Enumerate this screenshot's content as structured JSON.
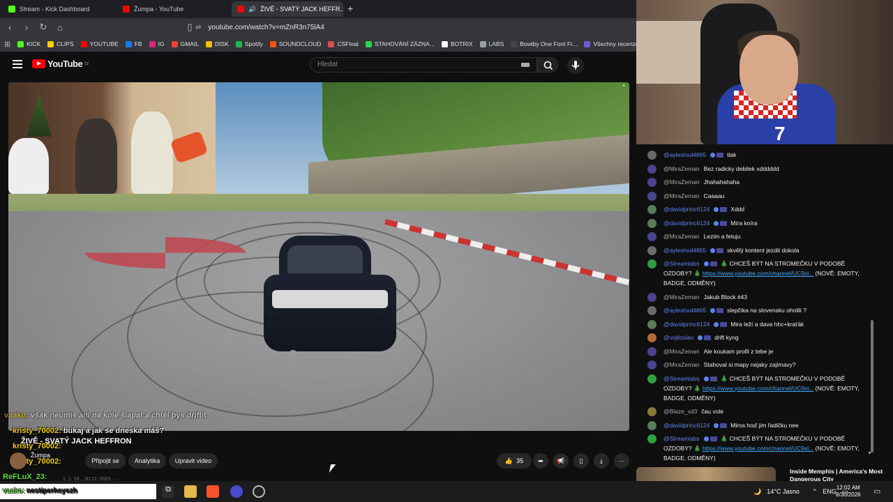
{
  "tabs": [
    {
      "label": "Stream - Kick Dashboard",
      "color": "#53fc18"
    },
    {
      "label": "Žumpa - YouTube",
      "color": "#ff0000"
    },
    {
      "label": "ŽIVĚ - SVATÝ JACK HEFFR...",
      "color": "#ff0000"
    }
  ],
  "new_tab": "+",
  "url": "youtube.com/watch?v=mZnR3n75lA4",
  "bookmarks": [
    {
      "label": "KICK",
      "color": "#53fc18"
    },
    {
      "label": "CLIPS",
      "color": "#f5d000"
    },
    {
      "label": "YOUTUBE",
      "color": "#ff0000"
    },
    {
      "label": "FB",
      "color": "#1877f2"
    },
    {
      "label": "IG",
      "color": "#d62976"
    },
    {
      "label": "GMAIL",
      "color": "#ea4335"
    },
    {
      "label": "DISK",
      "color": "#fbbc04"
    },
    {
      "label": "Spotify",
      "color": "#1db954"
    },
    {
      "label": "SOUNDCLOUD",
      "color": "#ff5500"
    },
    {
      "label": "CSFloat",
      "color": "#e24c4c"
    },
    {
      "label": "STAHOVÁNÍ ZÁZNA...",
      "color": "#2fd152"
    },
    {
      "label": "BOTRIX",
      "color": "#ffffff"
    },
    {
      "label": "LABS",
      "color": "#9aa0a6"
    },
    {
      "label": "Bowlby One Font Fr...",
      "color": "#444444"
    },
    {
      "label": "Všechny recenze",
      "color": "#6f5bd7"
    }
  ],
  "youtube": {
    "logo": "YouTube",
    "logo_sup": "CZ",
    "search_placeholder": "Hledat"
  },
  "overlay": {
    "line1_nick": "vaako:",
    "line1_text": "však neumíš ani na kole šlapat a chtěl bys driftit",
    "line2_nick": "kristy_70002:",
    "line2_text": "bukaj a jak se dneska máš?",
    "line3_nick": "kristy_70002:",
    "line4_nick": "kristy_70002:",
    "line5_nick": "ReFLuX_23:",
    "taskbar_nick": "vaako:",
    "taskbar_text": "nestiperheyezh"
  },
  "video": {
    "title": "ŽIVĚ - SVATÝ JACK HEFFRON",
    "channel": "Žumpa",
    "join_label": "Připojit se",
    "analytics_label": "Analytika",
    "edit_label": "Upravit video",
    "likes": "35",
    "meta": "1. 1. 20... 30.12. 2023 · ..."
  },
  "chat": [
    {
      "author": "@ayleshxd4865",
      "mod": true,
      "text": "tlak",
      "color": "#6a6a6a"
    },
    {
      "author": "@MiraZeman",
      "mod": false,
      "text": "Bez radicky debilek xdddddd",
      "color": "#4a4490"
    },
    {
      "author": "@MiraZeman",
      "mod": false,
      "text": "Jhahahahaha",
      "color": "#4a4490"
    },
    {
      "author": "@MiraZeman",
      "mod": false,
      "text": "Caaaau",
      "color": "#4a4490"
    },
    {
      "author": "@davidprinc6124",
      "mod": true,
      "text": "Xddd",
      "color": "#5b7b5b"
    },
    {
      "author": "@davidprinc6124",
      "mod": true,
      "text": "Míra kníra",
      "color": "#5b7b5b"
    },
    {
      "author": "@MiraZeman",
      "mod": false,
      "text": "Lezim a fetuju",
      "color": "#4a4490"
    },
    {
      "author": "@ayleshxd4865",
      "mod": true,
      "text": "skvělý kontent jezdit dokola",
      "color": "#6a6a6a"
    },
    {
      "author": "@Streamlabs",
      "mod": true,
      "text": "🎄 CHCEŠ BÝT NA STROMEČKU V PODOBĚ OZDOBY? 🎄",
      "link": "https://www.youtube.com/channel/UC9xl...",
      "suffix": "(NOVĚ: EMOTY, BADGE, ODMĚNY)",
      "color": "#2f9e44"
    },
    {
      "author": "@MiraZeman",
      "mod": false,
      "text": "Jakub Block #43",
      "color": "#4a4490"
    },
    {
      "author": "@ayleshxd4865",
      "mod": true,
      "text": "slepčika na slovensku oholili ?",
      "color": "#6a6a6a"
    },
    {
      "author": "@davidprinc6124",
      "mod": true,
      "text": "Mira leží a dava hhc+kraťák",
      "color": "#5b7b5b"
    },
    {
      "author": "@vojtizslav",
      "mod": true,
      "text": "drift kyng",
      "color": "#b36a3a"
    },
    {
      "author": "@MiraZeman",
      "mod": false,
      "text": "Ale koukam profil z tebe je",
      "color": "#4a4490"
    },
    {
      "author": "@MiraZeman",
      "mod": false,
      "text": "Stahoval si mapy nejaky zajimavy?",
      "color": "#4a4490"
    },
    {
      "author": "@Streamlabs",
      "mod": true,
      "text": "🎄 CHCEŠ BÝT NA STROMEČKU V PODOBĚ OZDOBY? 🎄",
      "link": "https://www.youtube.com/channel/UC9xl...",
      "suffix": "(NOVĚ: EMOTY, BADGE, ODMĚNY)",
      "color": "#2f9e44"
    },
    {
      "author": "@Blaze_xd3",
      "mod": false,
      "text": "čau vole",
      "color": "#8a7a3a"
    },
    {
      "author": "@davidprinc6124",
      "mod": true,
      "text": "Miros hoď jim řadičku nee",
      "color": "#5b7b5b"
    },
    {
      "author": "@Streamlabs",
      "mod": true,
      "text": "🎄 CHCEŠ BÝT NA STROMEČKU V PODOBĚ OZDOBY? 🎄",
      "link": "https://www.youtube.com/channel/UC9xl...",
      "suffix": "(NOVĚ: EMOTY, BADGE, ODMĚNY)",
      "color": "#2f9e44"
    }
  ],
  "recommendation": {
    "title": "Inside Memphis | America's Most Dangerous City"
  },
  "taskbar": {
    "weather": "14°C Jasno",
    "lang": "ENG",
    "time": "12:02 AM",
    "date": "8/30/2026"
  }
}
